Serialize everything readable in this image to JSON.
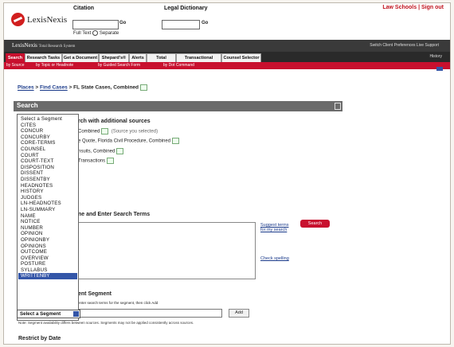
{
  "header": {
    "logo_text": "LexisNexis",
    "citation_label": "Citation",
    "legal_dictionary_label": "Legal Dictionary",
    "go_label": "Go",
    "go_label2": "Go",
    "full_text_label": "Full Text",
    "separate_label": "Separate",
    "top_links": "Law Schools | Sign out"
  },
  "brandbar": {
    "brand": "LexisNexis",
    "subtitle": "Total Research System",
    "right_links": "Switch Client  Preferences  Live Support"
  },
  "tabs": [
    {
      "label": "Search"
    },
    {
      "label": "Research Tasks"
    },
    {
      "label": "Get a Document"
    },
    {
      "label": "Shepard's®"
    },
    {
      "label": "Alerts"
    },
    {
      "label": "Total Litigator"
    },
    {
      "label": "Transactional Advisor"
    },
    {
      "label": "Counsel Selector"
    }
  ],
  "tabs_more": "History",
  "subnav": [
    {
      "label": "by Source"
    },
    {
      "label": "by Topic or Headnote"
    },
    {
      "label": "by Guided Search Form"
    },
    {
      "label": "by Dot Command"
    }
  ],
  "breadcrumb": {
    "link1": "Places",
    "sep1": " > ",
    "link2": "Find Cases",
    "rest": " > FL State Cases, Combined"
  },
  "search_panel": {
    "title": "Search",
    "additional_sources_heading": "rch with additional sources",
    "src1": "Combined",
    "src1_note": "(Source you selected)",
    "src2": "e Quote, Florida Civil Procedure, Combined",
    "src3": "nsuits, Combined",
    "src4": "Transactions",
    "enter_terms_heading": "ne and Enter Search Terms",
    "suggest_link": "Suggest terms for my search",
    "check_spelling_link": "Check spelling",
    "search_button": "Search",
    "segment_heading": "ent Segment",
    "segment_hint": "enter search terms for the segment, then click Add",
    "add_button": "Add",
    "note": "Note: Segment availability differs between sources. Segments may not be applied consistently across sources.",
    "restrict_heading": "Restrict by Date"
  },
  "segment_dropdown": {
    "items": [
      "Select a Segment",
      "CITES",
      "CONCUR",
      "CONCURBY",
      "CORE-TERMS",
      "COUNSEL",
      "COURT",
      "COURT-TEXT",
      "DISPOSITION",
      "DISSENT",
      "DISSENTBY",
      "HEADNOTES",
      "HISTORY",
      "JUDGES",
      "LN-HEADNOTES",
      "LN-SUMMARY",
      "NAME",
      "NOTICE",
      "NUMBER",
      "OPINION",
      "OPINIONBY",
      "OPINIONS",
      "OUTCOME",
      "OVERVIEW",
      "POSTURE",
      "SYLLABUS"
    ],
    "highlighted": "WRITTENBY",
    "selected_value": "Select a Segment"
  }
}
